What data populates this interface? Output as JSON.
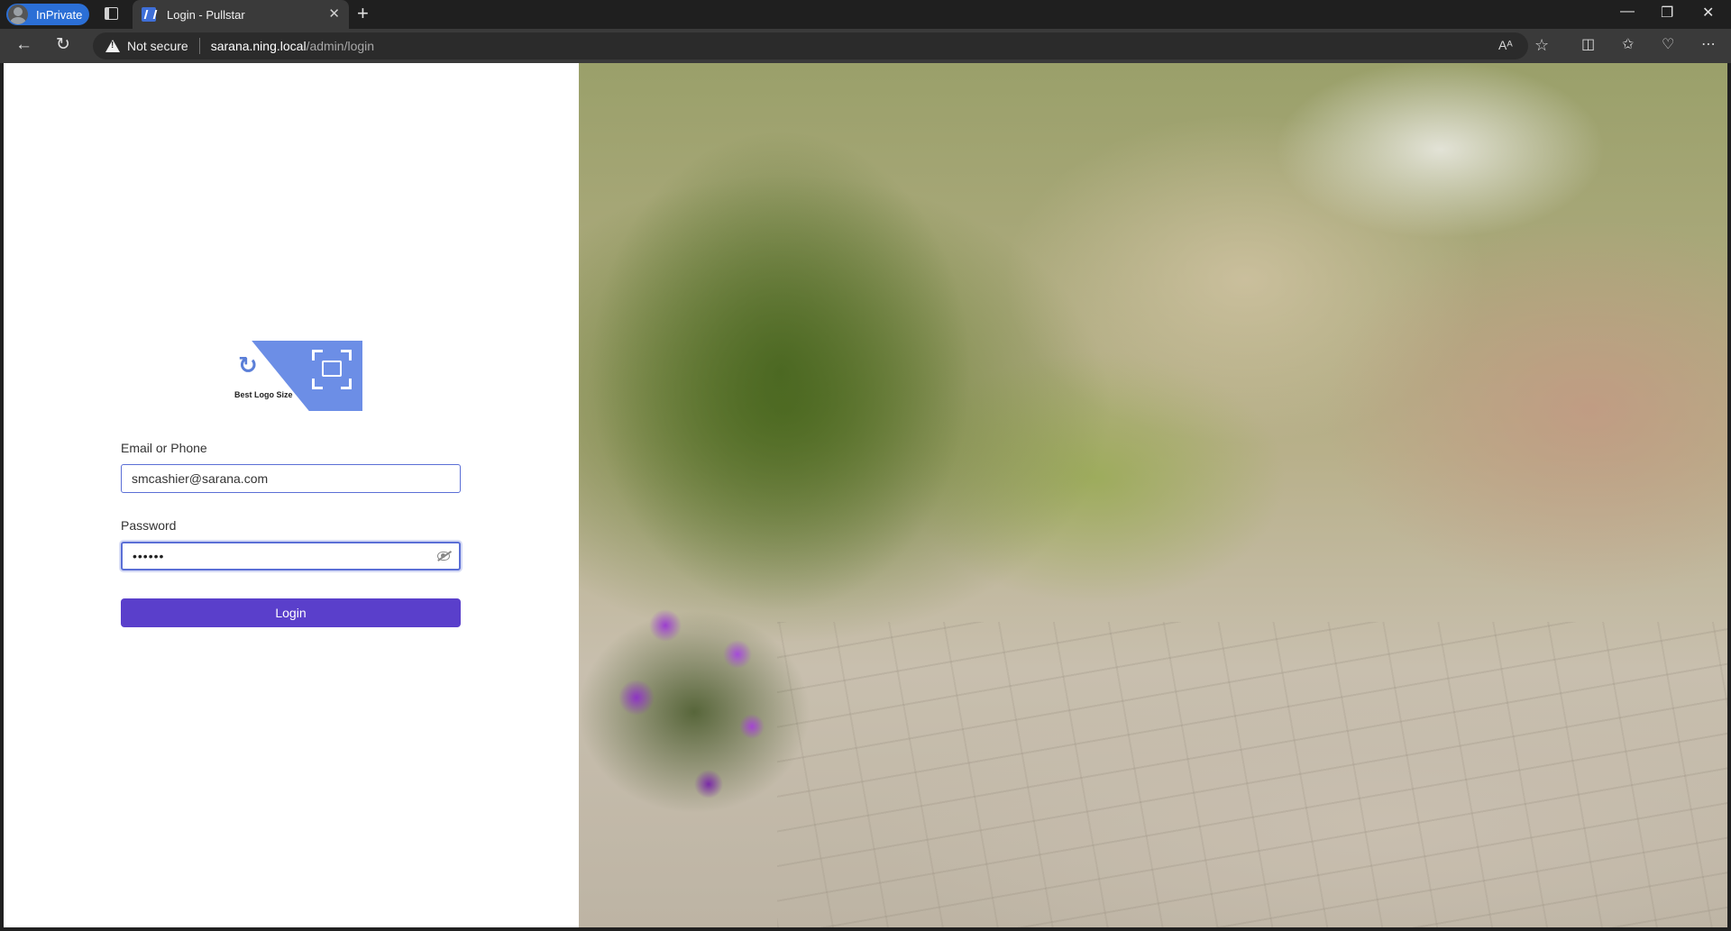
{
  "browser": {
    "inprivate_label": "InPrivate",
    "tab_title": "Login - Pullstar",
    "tab_close": "✕",
    "new_tab": "+",
    "security_label": "Not secure",
    "url_host": "sarana.ning.local",
    "url_path": "/admin/login",
    "icons": [
      "back-icon",
      "refresh-icon",
      "warning-icon",
      "read-aloud-icon",
      "favorite-icon",
      "split-screen-icon",
      "favorites-icon",
      "browser-essentials-icon",
      "more-icon"
    ],
    "window_controls": [
      "—",
      "❐",
      "✕"
    ]
  },
  "login": {
    "logo_text": "Best Logo Size",
    "email_label": "Email or Phone",
    "email_value": "smcashier@sarana.com",
    "password_label": "Password",
    "password_masked": "••••••",
    "login_button": "Login",
    "accent_color": "#5a3fcb"
  }
}
